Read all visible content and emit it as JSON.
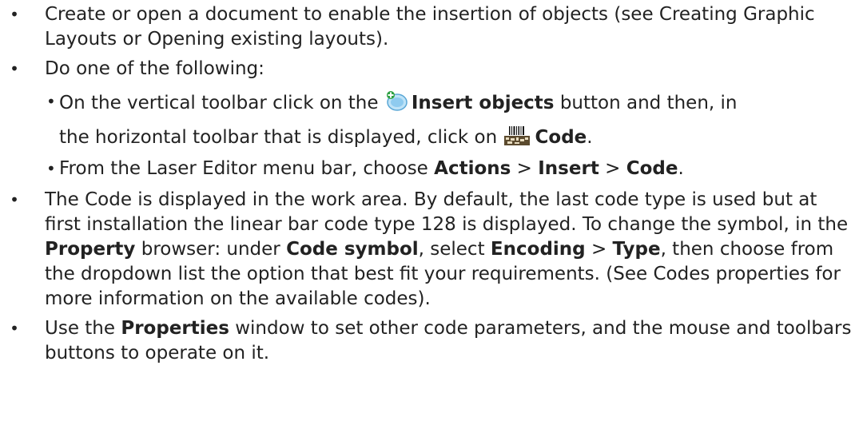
{
  "steps": {
    "s1": "Create or open a document to enable the insertion of objects (see Creating Graphic Layouts or Opening existing layouts).",
    "s2": "Do one of the following:",
    "s2a": {
      "t1": "On the vertical toolbar click on the",
      "t2": "Insert objects",
      "t3": "button and then, in",
      "t4": "the horizontal toolbar that is displayed, click on",
      "t5": "Code",
      "t6": "."
    },
    "s2b": {
      "t1": "From the Laser Editor menu bar, choose",
      "t2": "Actions",
      "t3": ">",
      "t4": "Insert",
      "t5": ">",
      "t6": "Code",
      "t7": "."
    },
    "s3": {
      "t1": "The Code is displayed in the work area. By default, the last code type is used but at first installation the linear bar code type 128 is displayed. To change the symbol, in the",
      "t2": "Property",
      "t3": "browser: under",
      "t4": "Code symbol",
      "t5": ", select",
      "t6": "Encoding",
      "t7": ">",
      "t8": "Type",
      "t9": ", then choose from the dropdown list the option that best fit your requirements. (See Codes properties for more information on the available codes)."
    },
    "s4": {
      "t1": "Use the",
      "t2": "Properties",
      "t3": "window to set other code parameters, and the mouse and toolbars buttons to operate on it."
    }
  },
  "icons": {
    "insert_objects": "insert-objects-icon",
    "code": "barcode-icon"
  },
  "colors": {
    "text": "#222222",
    "insert_icon_fill": "#7ec3ec",
    "insert_icon_plus": "#2ea043"
  }
}
